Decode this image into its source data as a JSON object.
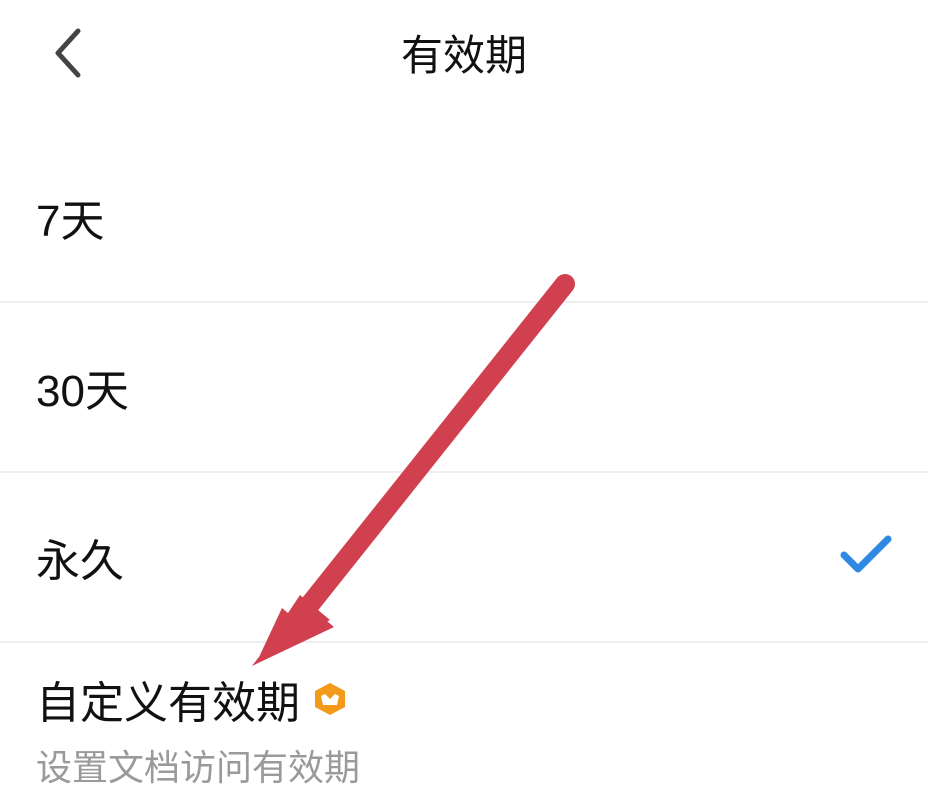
{
  "header": {
    "title": "有效期"
  },
  "options": [
    {
      "label": "7天",
      "selected": false
    },
    {
      "label": "30天",
      "selected": false
    },
    {
      "label": "永久",
      "selected": true
    }
  ],
  "custom": {
    "label": "自定义有效期",
    "subtitle": "设置文档访问有效期"
  },
  "colors": {
    "accent_check": "#2f89e3",
    "badge": "#f39a1a",
    "arrow": "#d1404e"
  }
}
